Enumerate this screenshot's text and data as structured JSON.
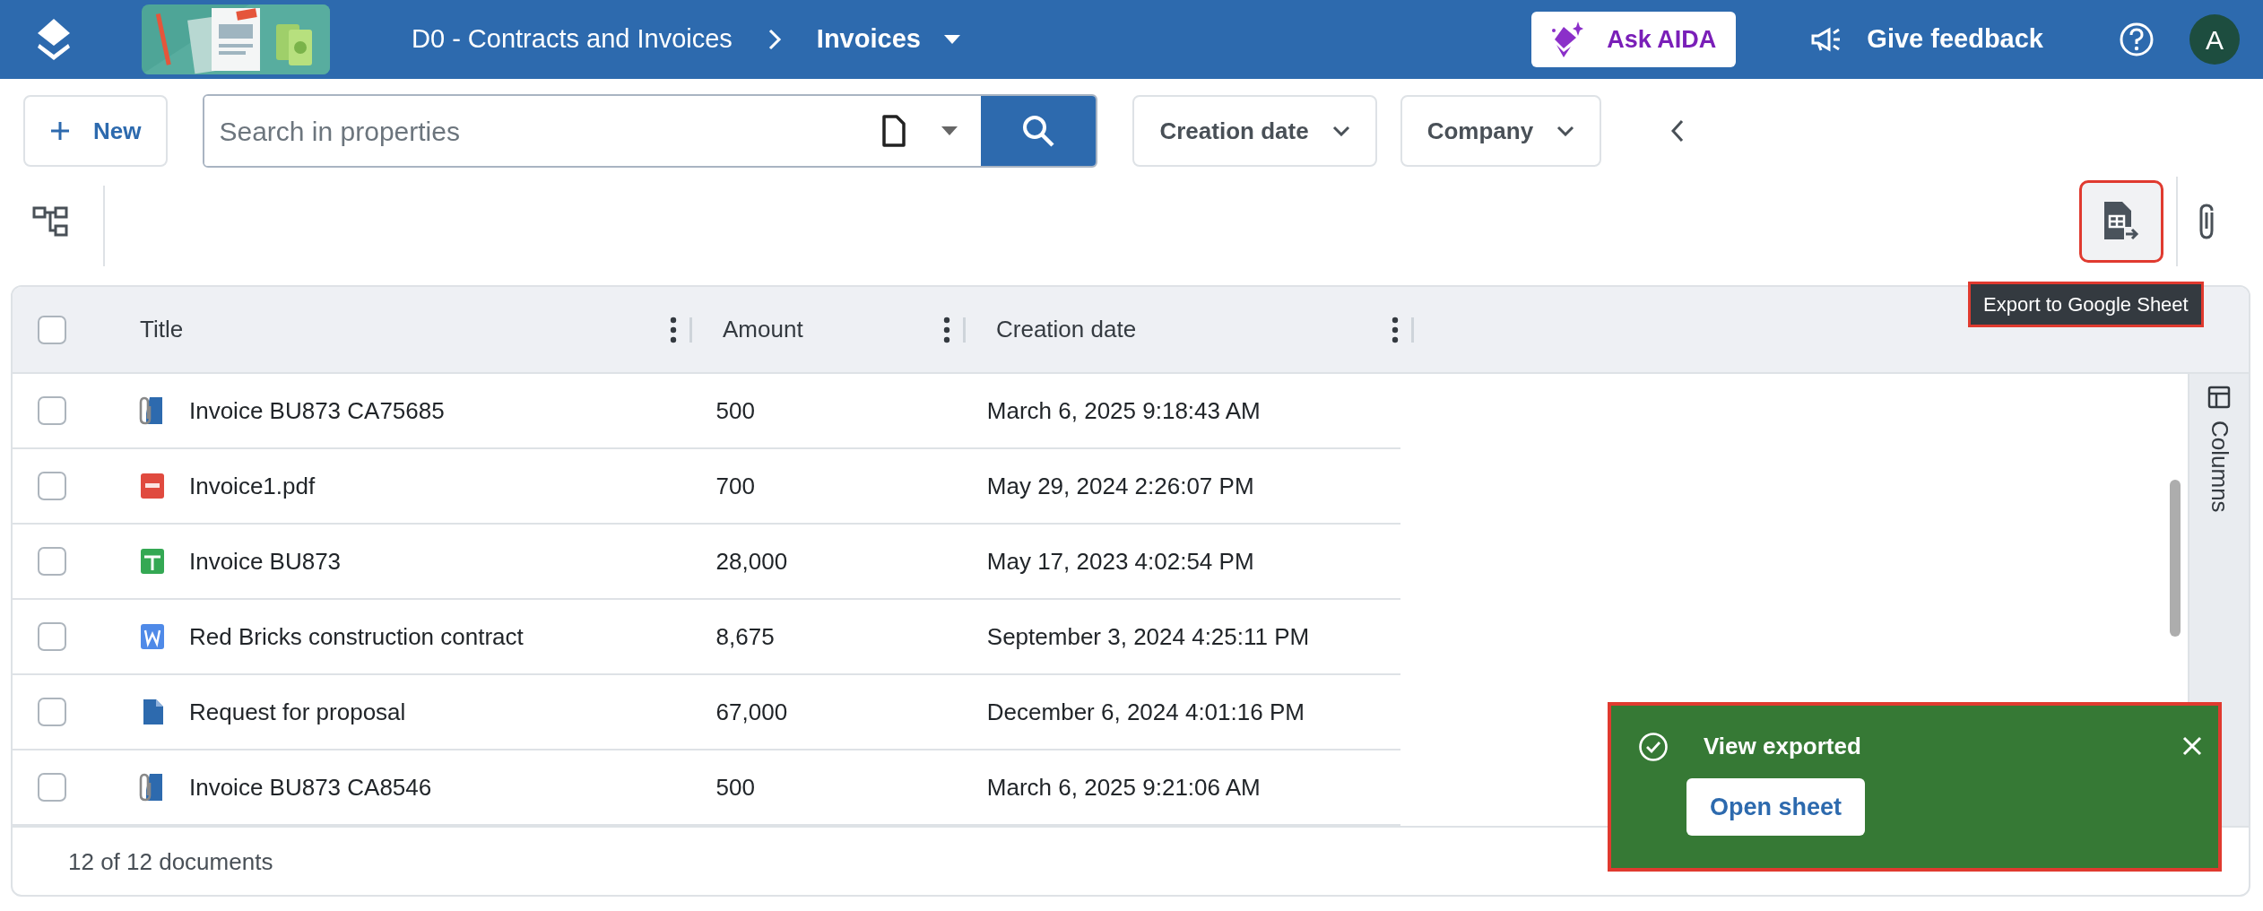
{
  "header": {
    "breadcrumb": [
      {
        "label": "D0 - Contracts and Invoices"
      },
      {
        "label": "Invoices"
      }
    ],
    "ask_button": "Ask AIDA",
    "feedback_button": "Give feedback",
    "avatar": "A"
  },
  "toolbar": {
    "new_button": "New",
    "search": {
      "placeholder": "Search in properties"
    },
    "filters": [
      "Creation date",
      "Company"
    ]
  },
  "export_button": {
    "highlighted": true
  },
  "tooltip": {
    "text": "Export to Google Sheet",
    "highlighted": true
  },
  "table": {
    "select_all_checked": false,
    "columns": [
      "Title",
      "Amount",
      "Creation date"
    ],
    "rows": [
      {
        "kind": "attachment",
        "title": "Invoice BU873 CA75685",
        "amount": "500",
        "date": "March 6, 2025 9:18:43 AM",
        "checked": false
      },
      {
        "kind": "pdf",
        "title": "Invoice1.pdf",
        "amount": "700",
        "date": "May 29, 2024 2:26:07 PM",
        "checked": false
      },
      {
        "kind": "sheet",
        "title": "Invoice BU873",
        "amount": "28,000",
        "date": "May 17, 2023 4:02:54 PM",
        "checked": false
      },
      {
        "kind": "word",
        "title": "Red Bricks construction contract",
        "amount": "8,675",
        "date": "September 3, 2024 4:25:11 PM",
        "checked": false
      },
      {
        "kind": "doc",
        "title": "Request for proposal",
        "amount": "67,000",
        "date": "December 6, 2024 4:01:16 PM",
        "checked": false
      },
      {
        "kind": "attachment",
        "title": "Invoice BU873 CA8546",
        "amount": "500",
        "date": "March 6, 2025 9:21:06 AM",
        "checked": false
      }
    ]
  },
  "side_panel": {
    "label": "Columns"
  },
  "footer": "12 of 12 documents",
  "toast": {
    "message": "View exported",
    "action": "Open sheet",
    "highlighted": true
  }
}
